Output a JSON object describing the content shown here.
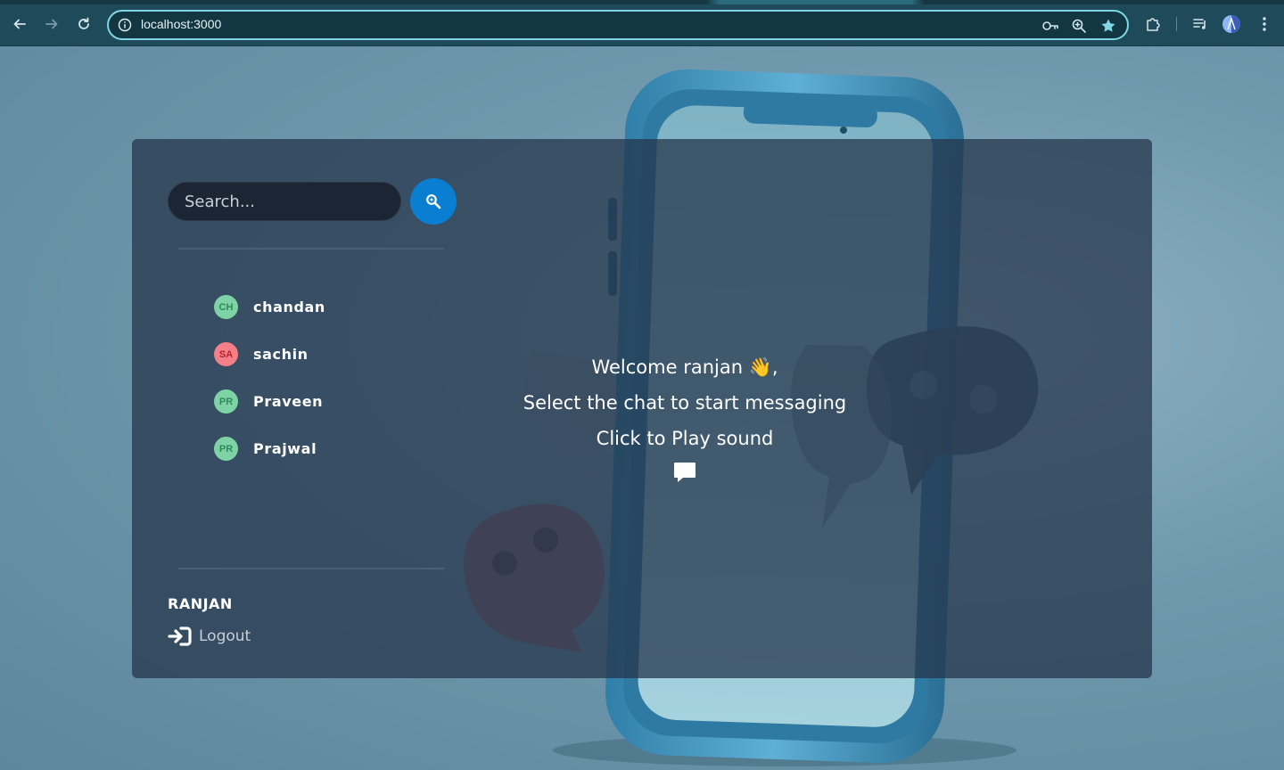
{
  "browser": {
    "url": "localhost:3000",
    "icons": [
      "back-icon",
      "forward-icon",
      "reload-icon",
      "site-info-icon",
      "password-key-icon",
      "zoom-icon",
      "bookmark-star-icon",
      "extensions-icon",
      "media-queue-icon",
      "profile-avatar",
      "more-menu-icon"
    ]
  },
  "sidebar": {
    "search": {
      "placeholder": "Search..."
    },
    "contacts": [
      {
        "name": "chandan",
        "initials": "CH",
        "avatar_bg": "#7ed3a6",
        "avatar_fg": "#2e8a5a"
      },
      {
        "name": "sachin",
        "initials": "SA",
        "avatar_bg": "#f47f86",
        "avatar_fg": "#b5232e"
      },
      {
        "name": "Praveen",
        "initials": "PR",
        "avatar_bg": "#7ed3a6",
        "avatar_fg": "#2e8a5a"
      },
      {
        "name": "Prajwal",
        "initials": "PR",
        "avatar_bg": "#7ed3a6",
        "avatar_fg": "#2e8a5a"
      }
    ],
    "current_user": "RANJAN",
    "logout_label": "Logout"
  },
  "main": {
    "welcome_line": "Welcome ranjan 👋,",
    "instruction_line": "Select the chat to start messaging",
    "sound_line": "Click to Play sound"
  },
  "colors": {
    "accent": "#0a7fd1",
    "omnibox_border": "#7fd6e4",
    "panel_bg": "rgba(36,52,74,0.74)"
  }
}
